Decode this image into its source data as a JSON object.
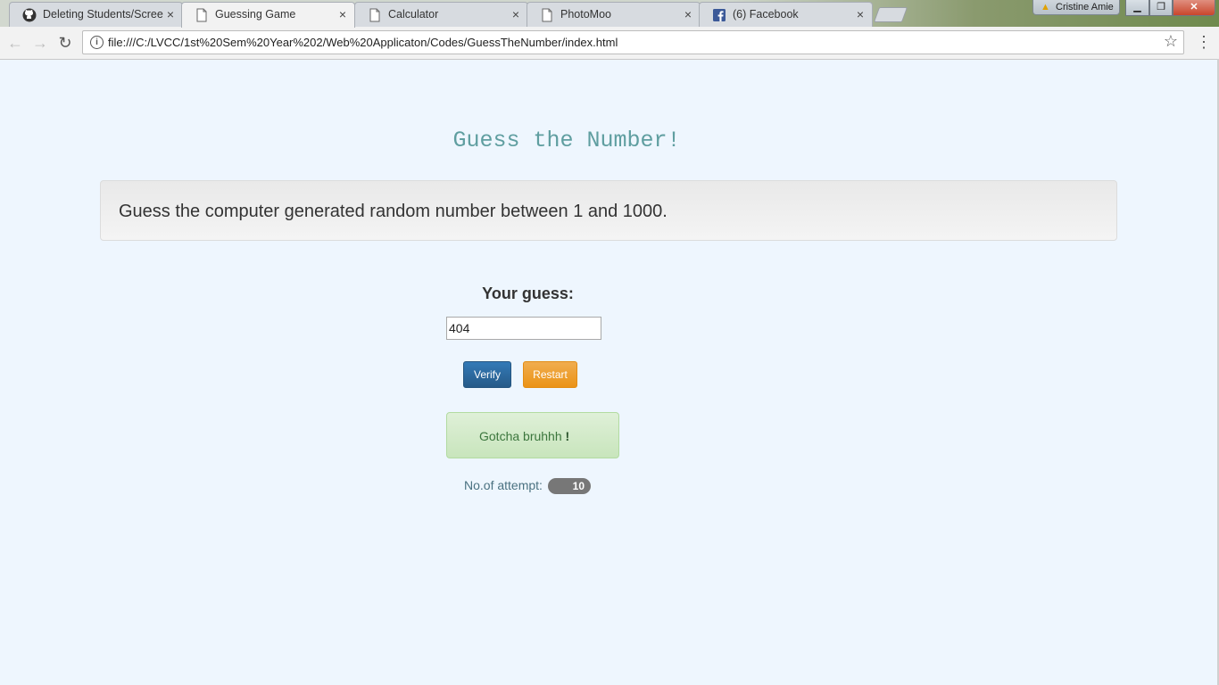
{
  "browser": {
    "tabs": [
      {
        "title": "Deleting Students/Screen",
        "icon": "github-icon",
        "active": false
      },
      {
        "title": "Guessing Game",
        "icon": "document-icon",
        "active": true
      },
      {
        "title": "Calculator",
        "icon": "document-icon",
        "active": false
      },
      {
        "title": "PhotoMoo",
        "icon": "document-icon",
        "active": false
      },
      {
        "title": "(6) Facebook",
        "icon": "facebook-icon",
        "active": false
      }
    ],
    "close_glyph": "×",
    "profile_name": "Cristine Amie",
    "url": "file:///C:/LVCC/1st%20Sem%20Year%202/Web%20Applicaton/Codes/GuessTheNumber/index.html"
  },
  "page": {
    "title": "Guess the Number!",
    "instructions": "Guess the computer generated random number between 1 and 1000.",
    "guess_label": "Your guess:",
    "guess_value": "404",
    "verify_label": "Verify",
    "restart_label": "Restart",
    "result_message": "Gotcha bruhhh",
    "result_suffix": "!",
    "attempt_label": "No.of attempt:",
    "attempt_count": "10"
  },
  "colors": {
    "page_background": "#eef6fe",
    "title_color": "#5f9ea0",
    "verify_button": "#265a88",
    "restart_button": "#eb9316",
    "success_alert": "#dff0d8",
    "badge": "#777777"
  }
}
